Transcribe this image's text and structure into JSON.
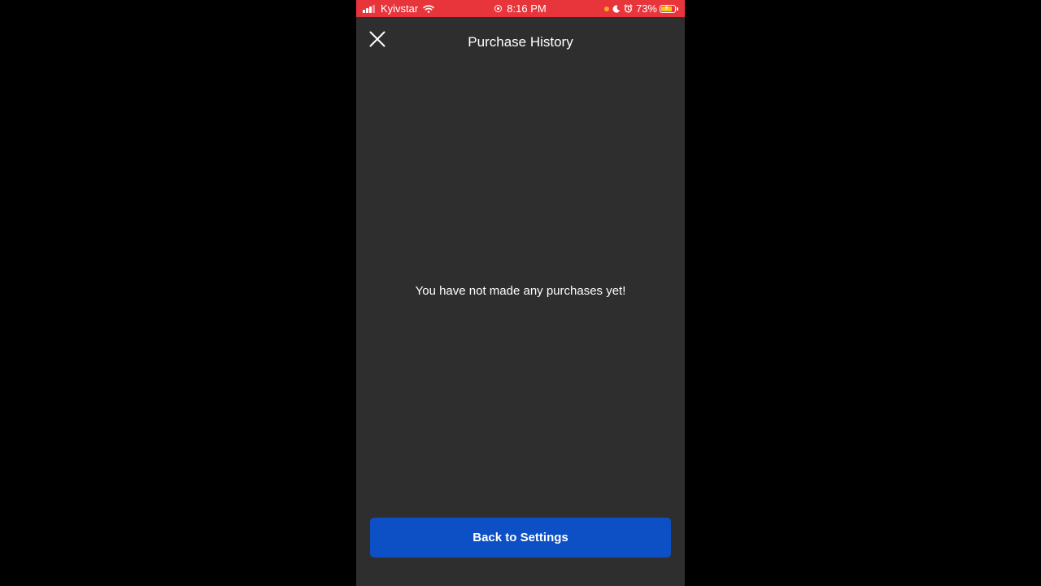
{
  "status_bar": {
    "carrier": "Kyivstar",
    "time": "8:16 PM",
    "battery_percent": "73%",
    "background_color": "#e8353c",
    "icons": [
      "signal-icon",
      "wifi-icon",
      "screen-record-icon",
      "orange-dot-indicator",
      "moon-icon",
      "alarm-icon",
      "battery-charging-icon"
    ]
  },
  "header": {
    "title": "Purchase History",
    "close_icon": "close-icon"
  },
  "main": {
    "empty_message": "You have not made any purchases yet!"
  },
  "footer": {
    "back_button_label": "Back to Settings",
    "button_color": "#0d4fc4"
  },
  "theme": {
    "screen_background": "#2e2e2f",
    "letterbox_background": "#000000"
  }
}
